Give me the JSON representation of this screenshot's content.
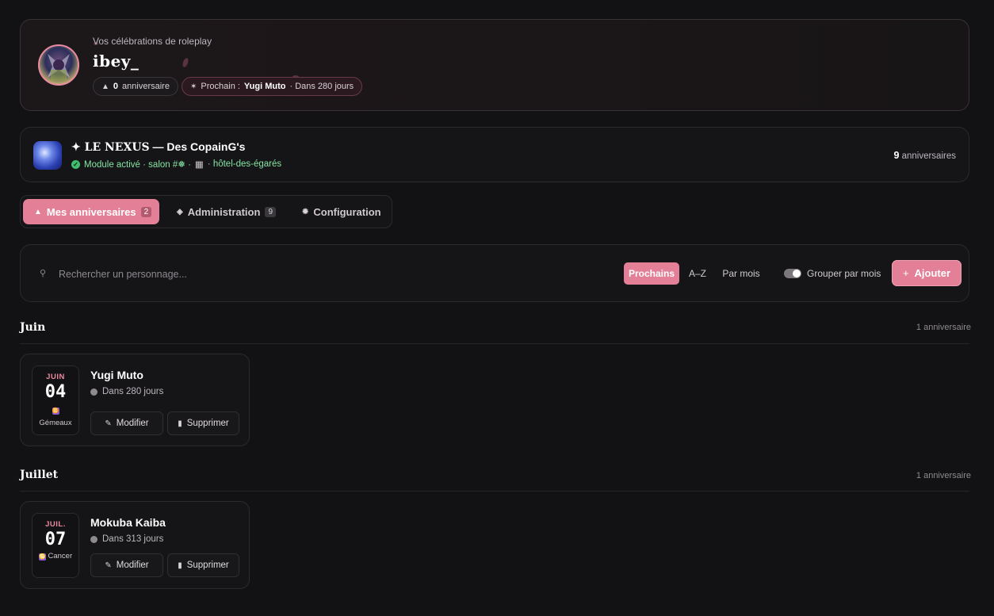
{
  "profile": {
    "subtitle": "Vos célébrations de roleplay",
    "username": "ibey_",
    "count_value": "0",
    "count_label": "anniversaire",
    "next_label": "Prochain :",
    "next_name": "Yugi Muto",
    "next_when": "· Dans 280 jours"
  },
  "server": {
    "name_left": "✦ LE NEXUS",
    "name_right": "— Des CopainG's",
    "status": "Module activé · salon #❅ ·",
    "channel": "· hôtel-des-égarés",
    "count_value": "9",
    "count_label": "anniversaires"
  },
  "tabs": [
    {
      "label": "Mes anniversaires",
      "badge": "2",
      "icon": "cake-icon"
    },
    {
      "label": "Administration",
      "badge": "9",
      "icon": "shield-icon"
    },
    {
      "label": "Configuration",
      "icon": "gear-icon"
    }
  ],
  "toolbar": {
    "search_placeholder": "Rechercher un personnage...",
    "sort": [
      "Prochains",
      "A–Z",
      "Par mois"
    ],
    "group_label": "Grouper par mois",
    "add_label": "Ajouter"
  },
  "months": [
    {
      "title": "Juin",
      "count": "1 anniversaire",
      "card": {
        "mon": "JUIN",
        "day": "04",
        "zodiac_symbol": "♊",
        "zodiac": "Gémeaux",
        "name": "Yugi Muto",
        "when": "Dans 280 jours",
        "edit": "Modifier",
        "delete": "Supprimer"
      }
    },
    {
      "title": "Juillet",
      "count": "1 anniversaire",
      "card": {
        "mon": "JUIL.",
        "day": "07",
        "zodiac_symbol": "♋",
        "zodiac": "Cancer",
        "name": "Mokuba Kaiba",
        "when": "Dans 313 jours",
        "edit": "Modifier",
        "delete": "Supprimer"
      }
    }
  ],
  "colors": {
    "accent": "#e37f96",
    "success": "#84e3a3",
    "bg": "#121113"
  }
}
